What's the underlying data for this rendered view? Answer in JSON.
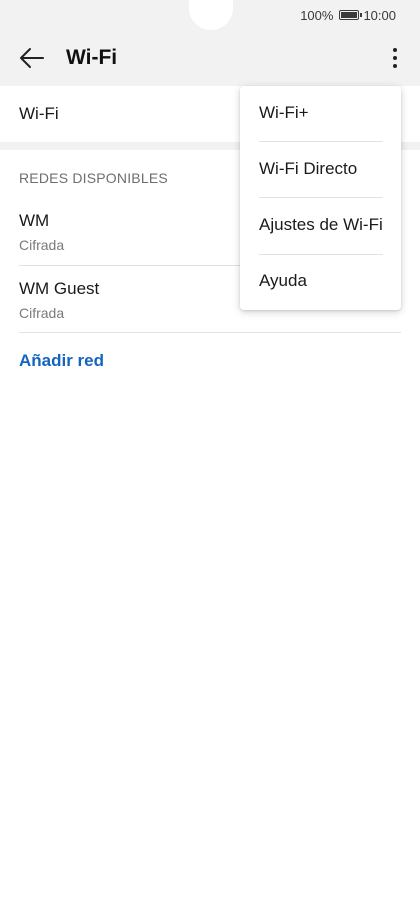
{
  "status_bar": {
    "battery_percent": "100%",
    "time": "10:00"
  },
  "app_bar": {
    "title": "Wi-Fi",
    "back_icon": "arrow-left-icon",
    "more_icon": "more-vertical-icon"
  },
  "wifi_toggle": {
    "label": "Wi-Fi"
  },
  "networks": {
    "section_title": "REDES DISPONIBLES",
    "items": [
      {
        "name": "WM",
        "security": "Cifrada"
      },
      {
        "name": "WM Guest",
        "security": "Cifrada"
      }
    ],
    "add_label": "Añadir red"
  },
  "overflow_menu": {
    "items": [
      {
        "label": "Wi-Fi+"
      },
      {
        "label": "Wi-Fi Directo"
      },
      {
        "label": "Ajustes de Wi-Fi"
      },
      {
        "label": "Ayuda"
      }
    ]
  },
  "colors": {
    "accent": "#1565c0",
    "background": "#ffffff",
    "header_bg": "#f2f2f2"
  }
}
